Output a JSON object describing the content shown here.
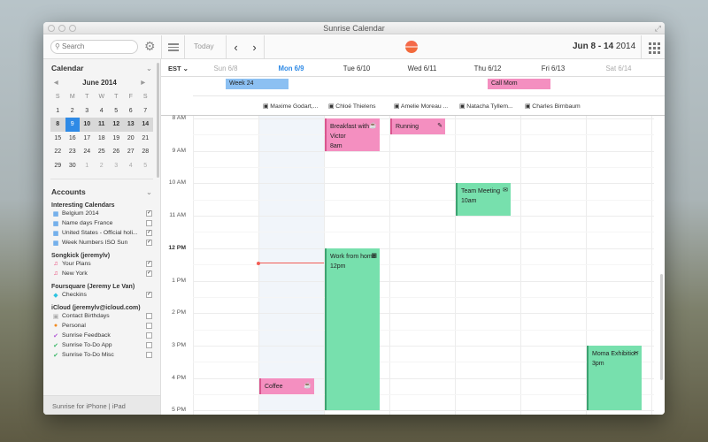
{
  "window": {
    "title": "Sunrise Calendar"
  },
  "toolbar": {
    "search_placeholder": "Search",
    "today_label": "Today",
    "prev_label": "‹",
    "next_label": "›",
    "date_range": "Jun 8 - 14",
    "date_year": "2014"
  },
  "sidebar": {
    "calendar_title": "Calendar",
    "mini_month": "June 2014",
    "weekday_initials": [
      "S",
      "M",
      "T",
      "W",
      "T",
      "F",
      "S"
    ],
    "weeks": [
      [
        "1",
        "2",
        "3",
        "4",
        "5",
        "6",
        "7"
      ],
      [
        "8",
        "9",
        "10",
        "11",
        "12",
        "13",
        "14"
      ],
      [
        "15",
        "16",
        "17",
        "18",
        "19",
        "20",
        "21"
      ],
      [
        "22",
        "23",
        "24",
        "25",
        "26",
        "27",
        "28"
      ],
      [
        "29",
        "30",
        "1",
        "2",
        "3",
        "4",
        "5"
      ]
    ],
    "accounts_title": "Accounts",
    "groups": [
      {
        "title": "Interesting Calendars",
        "items": [
          {
            "name": "Belgium 2014",
            "icon": "calendar-icon",
            "color": "#2e8ae6",
            "checked": true
          },
          {
            "name": "Name days France",
            "icon": "calendar-icon",
            "color": "#2e8ae6",
            "checked": false
          },
          {
            "name": "United States - Official holi...",
            "icon": "calendar-icon",
            "color": "#2e8ae6",
            "checked": true
          },
          {
            "name": "Week Numbers ISO Sun",
            "icon": "calendar-icon",
            "color": "#2e8ae6",
            "checked": true
          }
        ]
      },
      {
        "title": "Songkick (jeremylv)",
        "items": [
          {
            "name": "Your Plans",
            "icon": "music-note-icon",
            "color": "#e8346a",
            "checked": true
          },
          {
            "name": "New York",
            "icon": "music-note-icon",
            "color": "#e8346a",
            "checked": true
          }
        ]
      },
      {
        "title": "Foursquare (Jeremy Le Van)",
        "items": [
          {
            "name": "Checkins",
            "icon": "foursquare-icon",
            "color": "#2ec3e0",
            "checked": true
          }
        ]
      },
      {
        "title": "iCloud (jeremylv@icloud.com)",
        "items": [
          {
            "name": "Contact Birthdays",
            "icon": "gift-icon",
            "color": "#aaaaaa",
            "checked": false
          },
          {
            "name": "Personal",
            "icon": "dot-icon",
            "color": "#f28a1e",
            "checked": false
          },
          {
            "name": "Sunrise Feedback",
            "icon": "check-icon",
            "color": "#b25ad6",
            "checked": false
          },
          {
            "name": "Sunrise To-Do App",
            "icon": "check-icon",
            "color": "#3db86a",
            "checked": false
          },
          {
            "name": "Sunrise To-Do Misc",
            "icon": "check-icon",
            "color": "#3db86a",
            "checked": false
          }
        ]
      }
    ],
    "footer": "Sunrise for iPhone | iPad"
  },
  "main": {
    "timezone": "EST",
    "days": [
      {
        "label": "Sun 6/8",
        "style": "weekend"
      },
      {
        "label": "Mon 6/9",
        "style": "today"
      },
      {
        "label": "Tue 6/10",
        "style": "normal"
      },
      {
        "label": "Wed 6/11",
        "style": "normal"
      },
      {
        "label": "Thu 6/12",
        "style": "normal"
      },
      {
        "label": "Fri 6/13",
        "style": "normal"
      },
      {
        "label": "Sat 6/14",
        "style": "weekend"
      }
    ],
    "allday_events": [
      {
        "title": "Week 24",
        "day": 0,
        "color": "#8cc0f2"
      },
      {
        "title": "Call Mom",
        "day": 4,
        "color": "#f48fc0"
      }
    ],
    "participants": [
      {
        "name": "Maxime Godart,...",
        "day": 1
      },
      {
        "name": "Chloé Thielens",
        "day": 2
      },
      {
        "name": "Amelie Moreau ...",
        "day": 3
      },
      {
        "name": "Natacha Tyllem...",
        "day": 4
      },
      {
        "name": "Charles Birnbaum",
        "day": 5
      }
    ],
    "hours": [
      "8 AM",
      "9 AM",
      "10 AM",
      "11 AM",
      "12 PM",
      "1 PM",
      "2 PM",
      "3 PM",
      "4 PM",
      "5 PM"
    ],
    "events": [
      {
        "title": "Breakfast with Victor",
        "time": "8am",
        "day": 2,
        "start": 8.0,
        "end": 9.0,
        "kind": "pink",
        "icon": "coffee-icon"
      },
      {
        "title": "Running",
        "time": "",
        "day": 3,
        "start": 8.0,
        "end": 8.5,
        "kind": "pink",
        "icon": "shoe-icon"
      },
      {
        "title": "Team Meeting",
        "time": "10am",
        "day": 4,
        "start": 10.0,
        "end": 11.0,
        "kind": "green",
        "icon": "chat-icon"
      },
      {
        "title": "Work from home",
        "time": "12pm",
        "day": 2,
        "start": 12.0,
        "end": 17.0,
        "kind": "green",
        "icon": "building-icon"
      },
      {
        "title": "Moma Exhibition",
        "time": "3pm",
        "day": 6,
        "start": 15.0,
        "end": 17.0,
        "kind": "green",
        "icon": "ticket-icon"
      },
      {
        "title": "Coffee",
        "time": "",
        "day": 1,
        "start": 16.0,
        "end": 16.5,
        "kind": "pink",
        "icon": "coffee-icon"
      }
    ],
    "now_hour": 12.45
  }
}
